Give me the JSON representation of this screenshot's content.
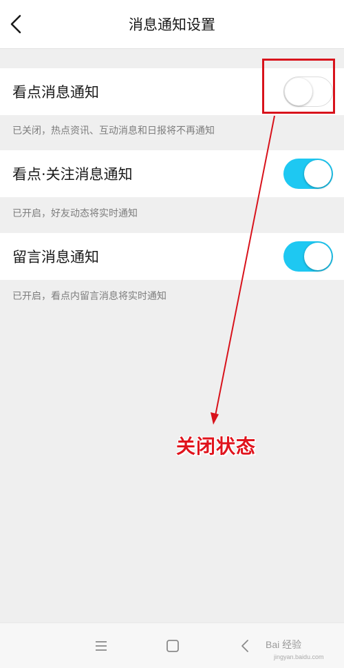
{
  "header": {
    "title": "消息通知设置",
    "back_icon": "chevron-left-icon"
  },
  "settings": [
    {
      "label": "看点消息通知",
      "enabled": false,
      "description": "已关闭，热点资讯、互动消息和日报将不再通知"
    },
    {
      "label": "看点·关注消息通知",
      "enabled": true,
      "description": "已开启，好友动态将实时通知"
    },
    {
      "label": "留言消息通知",
      "enabled": true,
      "description": "已开启，看点内留言消息将实时通知"
    }
  ],
  "annotation": {
    "text": "关闭状态",
    "color": "#e0141d"
  },
  "colors": {
    "toggle_on": "#1ec8f2",
    "annotation_red": "#d8121b"
  },
  "navbar": {
    "icons": [
      "menu-icon",
      "home-square-icon",
      "back-triangle-icon"
    ]
  },
  "watermark": {
    "text": "Bai 经验",
    "sub": "jingyan.baidu.com"
  }
}
